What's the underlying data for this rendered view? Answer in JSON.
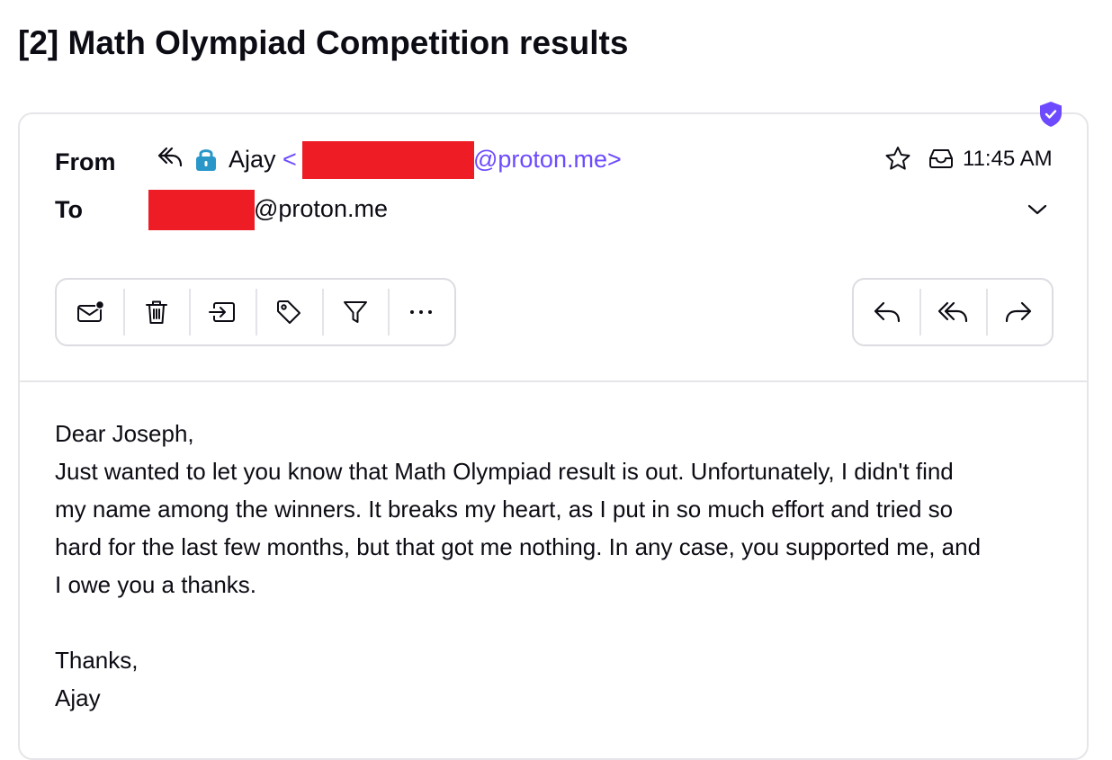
{
  "subject": "[2] Math Olympiad Competition results",
  "header": {
    "from_label": "From",
    "to_label": "To",
    "sender_name": "Ajay",
    "sender_open": "<",
    "sender_domain": "@proton.me>",
    "recipient_domain": "@proton.me",
    "time": "11:45 AM"
  },
  "toolbar_left": [
    {
      "icon": "mark-unread-icon"
    },
    {
      "icon": "trash-icon"
    },
    {
      "icon": "move-to-folder-icon"
    },
    {
      "icon": "label-icon"
    },
    {
      "icon": "filter-icon"
    },
    {
      "icon": "more-icon"
    }
  ],
  "toolbar_right": [
    {
      "icon": "reply-icon"
    },
    {
      "icon": "reply-all-icon"
    },
    {
      "icon": "forward-icon"
    }
  ],
  "body": {
    "greeting": "Dear Joseph,",
    "paragraph_line1": "Just wanted to let you know that Math Olympiad result is out. Unfortunately, I didn't find",
    "paragraph_line2": "my name among the winners. It breaks my heart, as I put in so much effort and tried so",
    "paragraph_line3": "hard for the last few months, but that got me nothing. In any case, you supported me, and",
    "paragraph_line4": "I owe you a thanks.",
    "signoff": "Thanks,",
    "signature": "Ajay"
  },
  "colors": {
    "accent": "#6d4aff",
    "lock": "#2a97c9",
    "redaction": "#ee1c25",
    "text": "#0c0c14",
    "border": "#e6e6ea"
  }
}
